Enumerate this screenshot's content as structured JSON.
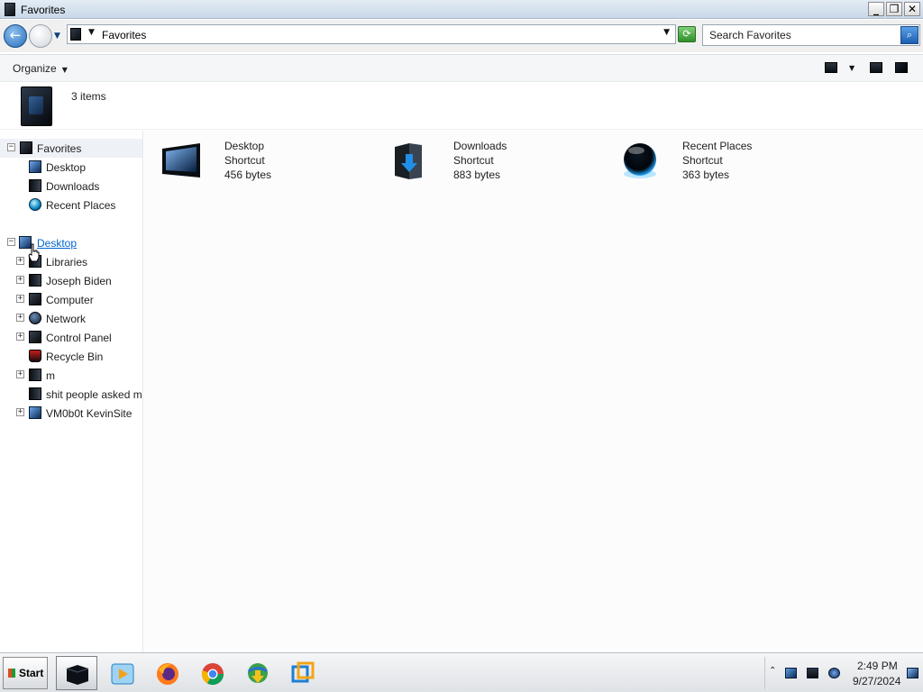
{
  "window": {
    "title": "Favorites"
  },
  "address_bar": {
    "crumb": "Favorites"
  },
  "search": {
    "placeholder": "Search Favorites"
  },
  "command_bar": {
    "organize_label": "Organize"
  },
  "details": {
    "item_count": "3 items"
  },
  "nav_pane": {
    "favorites_header": "Favorites",
    "favorites": [
      {
        "label": "Desktop",
        "icon": "desktop-icon"
      },
      {
        "label": "Downloads",
        "icon": "downloads-icon"
      },
      {
        "label": "Recent Places",
        "icon": "recent-places-icon"
      }
    ],
    "desktop_header": "Desktop",
    "desktop_children": [
      {
        "label": "Libraries",
        "icon": "libraries-icon",
        "expandable": true
      },
      {
        "label": "Joseph Biden",
        "icon": "user-folder-icon",
        "expandable": true
      },
      {
        "label": "Computer",
        "icon": "computer-icon",
        "expandable": true
      },
      {
        "label": "Network",
        "icon": "network-icon",
        "expandable": true
      },
      {
        "label": "Control Panel",
        "icon": "control-panel-icon",
        "expandable": true
      },
      {
        "label": "Recycle Bin",
        "icon": "recycle-bin-icon",
        "expandable": false
      },
      {
        "label": "m",
        "icon": "folder-icon",
        "expandable": true
      },
      {
        "label": "shit people asked m",
        "icon": "folder-icon",
        "expandable": false
      },
      {
        "label": "VM0b0t KevinSite",
        "icon": "folder-icon",
        "expandable": true
      }
    ]
  },
  "content": {
    "items": [
      {
        "name": "Desktop",
        "type": "Shortcut",
        "size": "456 bytes",
        "icon": "desktop-shortcut-icon"
      },
      {
        "name": "Downloads",
        "type": "Shortcut",
        "size": "883 bytes",
        "icon": "downloads-shortcut-icon"
      },
      {
        "name": "Recent Places",
        "type": "Shortcut",
        "size": "363 bytes",
        "icon": "recent-places-shortcut-icon"
      }
    ]
  },
  "taskbar": {
    "start_label": "Start",
    "apps": [
      {
        "name": "explorer",
        "icon": "explorer-icon",
        "active": true
      },
      {
        "name": "media player",
        "icon": "media-player-icon",
        "active": false
      },
      {
        "name": "firefox",
        "icon": "firefox-icon",
        "active": false
      },
      {
        "name": "chrome",
        "icon": "chrome-icon",
        "active": false
      },
      {
        "name": "internet download manager",
        "icon": "download-manager-icon",
        "active": false
      },
      {
        "name": "virtualbox",
        "icon": "virtualbox-icon",
        "active": false
      }
    ],
    "clock_time": "2:49 PM",
    "clock_date": "9/27/2024"
  }
}
